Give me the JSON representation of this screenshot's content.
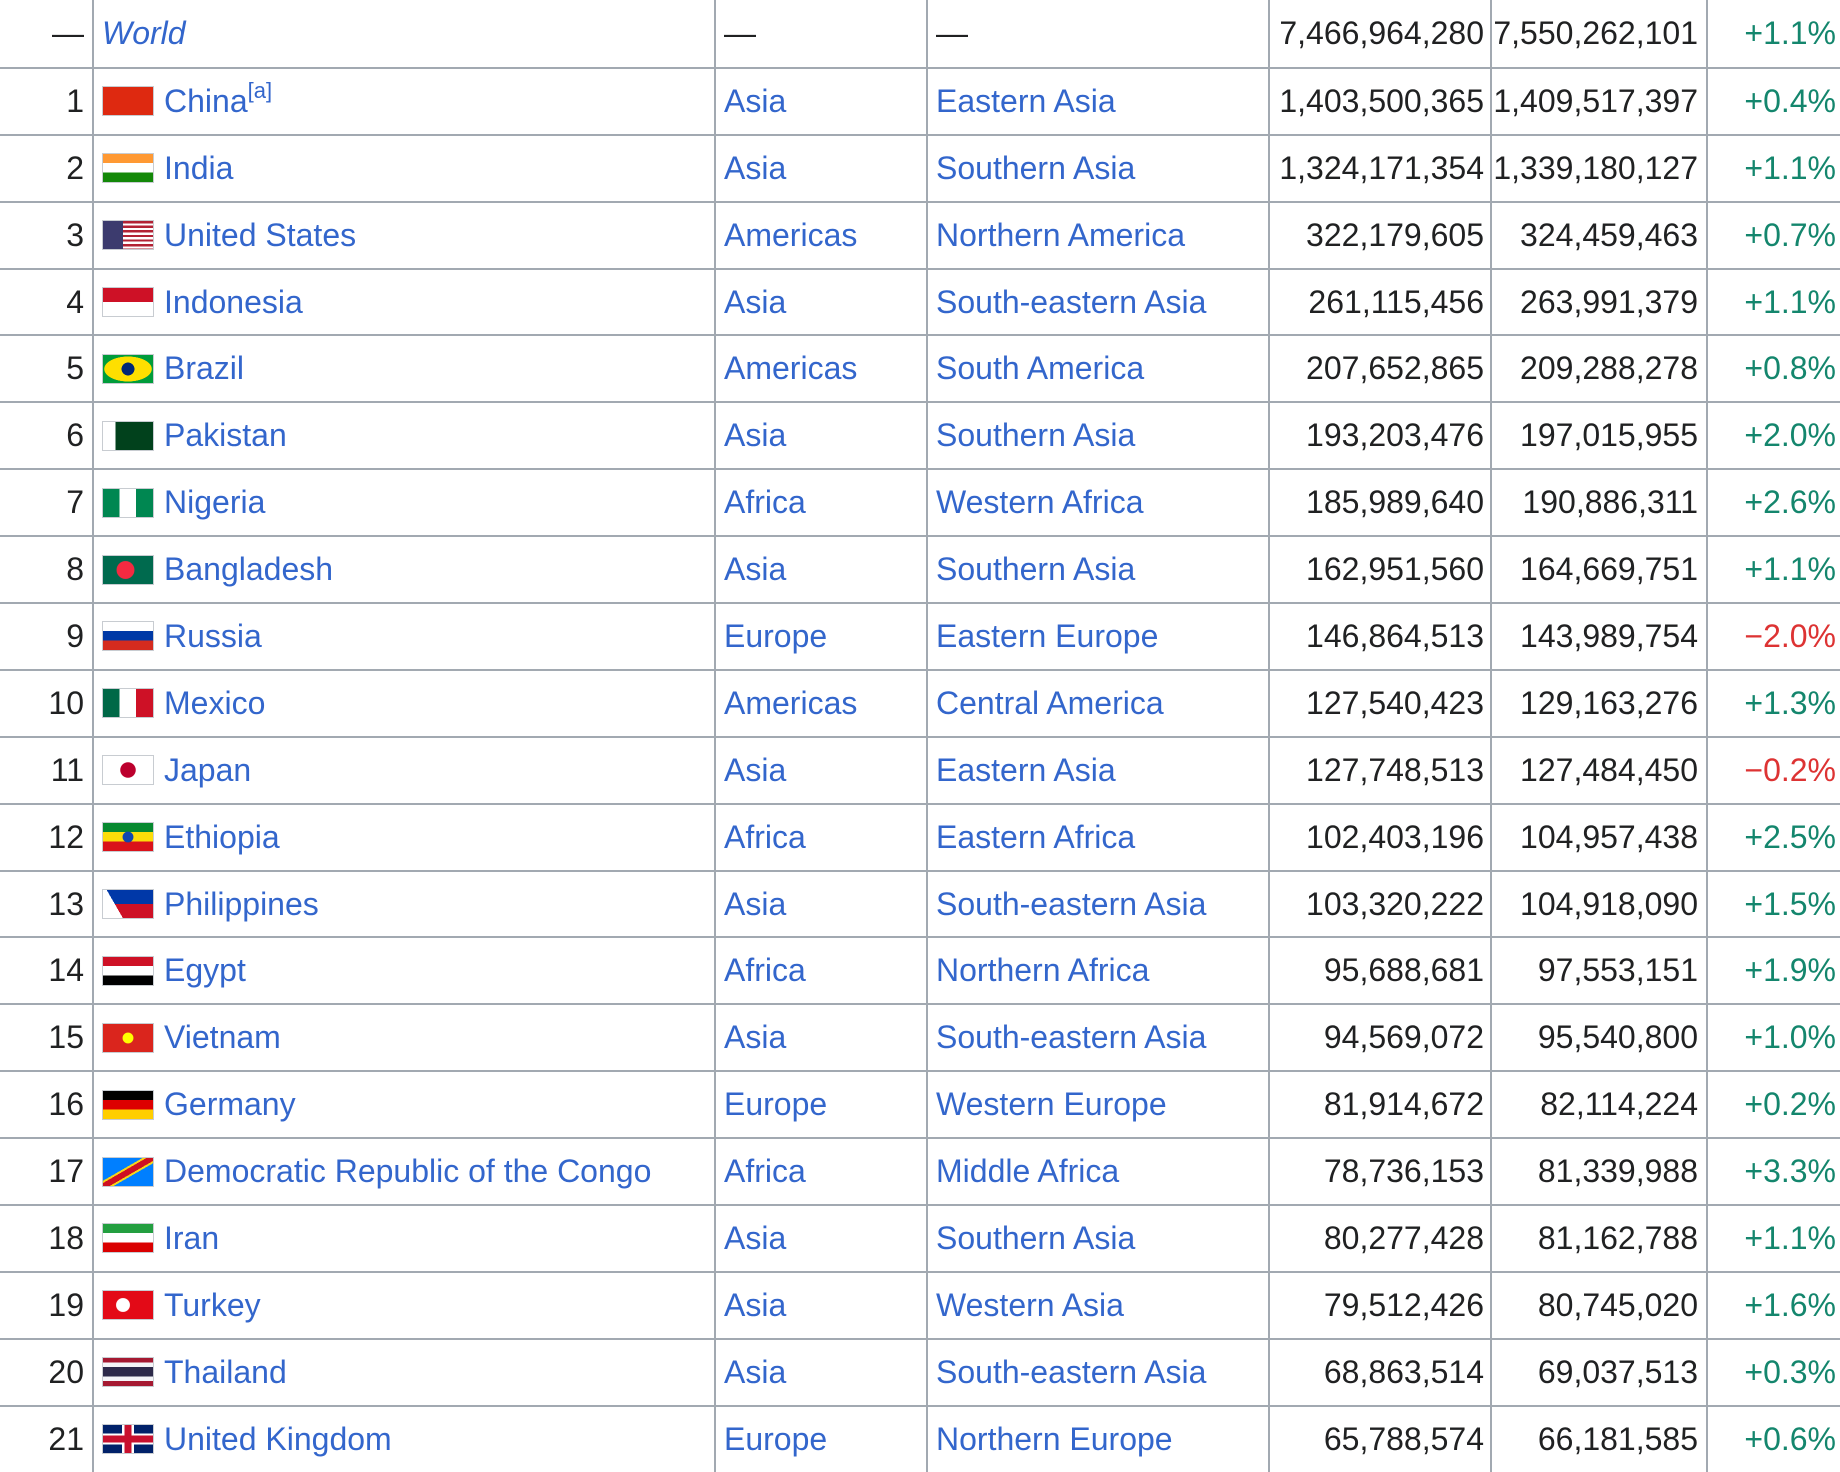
{
  "rows": [
    {
      "rank": "—",
      "country": "World",
      "note": "",
      "region": "—",
      "subregion": "—",
      "p2016": "7,466,964,280",
      "p2017": "7,550,262,101",
      "change": "+1.1%",
      "dir": "pos",
      "flag": "",
      "world": true
    },
    {
      "rank": "1",
      "country": "China",
      "note": "[a]",
      "region": "Asia",
      "subregion": "Eastern Asia",
      "p2016": "1,403,500,365",
      "p2017": "1,409,517,397",
      "change": "+0.4%",
      "dir": "pos",
      "flag": "linear-gradient(#de2910,#de2910)"
    },
    {
      "rank": "2",
      "country": "India",
      "note": "",
      "region": "Asia",
      "subregion": "Southern Asia",
      "p2016": "1,324,171,354",
      "p2017": "1,339,180,127",
      "change": "+1.1%",
      "dir": "pos",
      "flag": "linear-gradient(#ff9933 0 33%,#ffffff 33% 66%,#138808 66%)"
    },
    {
      "rank": "3",
      "country": "United States",
      "note": "",
      "region": "Americas",
      "subregion": "Northern America",
      "p2016": "322,179,605",
      "p2017": "324,459,463",
      "change": "+0.7%",
      "dir": "pos",
      "flag": "linear-gradient(90deg,#3c3b6e 0 40%,transparent 40%),repeating-linear-gradient(#b22234 0 2.3px,#ffffff 2.3px 4.6px)"
    },
    {
      "rank": "4",
      "country": "Indonesia",
      "note": "",
      "region": "Asia",
      "subregion": "South-eastern Asia",
      "p2016": "261,115,456",
      "p2017": "263,991,379",
      "change": "+1.1%",
      "dir": "pos",
      "flag": "linear-gradient(#ce1126 0 50%,#ffffff 50%)"
    },
    {
      "rank": "5",
      "country": "Brazil",
      "note": "",
      "region": "Americas",
      "subregion": "South America",
      "p2016": "207,652,865",
      "p2017": "209,288,278",
      "change": "+0.8%",
      "dir": "pos",
      "flag": "radial-gradient(circle,#002776 0 22%,transparent 23%),radial-gradient(ellipse 48% 45%,#fedf00 0 98%,transparent 100%),linear-gradient(#009c3b,#009c3b)"
    },
    {
      "rank": "6",
      "country": "Pakistan",
      "note": "",
      "region": "Asia",
      "subregion": "Southern Asia",
      "p2016": "193,203,476",
      "p2017": "197,015,955",
      "change": "+2.0%",
      "dir": "pos",
      "flag": "linear-gradient(90deg,#ffffff 0 25%,#01411c 25%)"
    },
    {
      "rank": "7",
      "country": "Nigeria",
      "note": "",
      "region": "Africa",
      "subregion": "Western Africa",
      "p2016": "185,989,640",
      "p2017": "190,886,311",
      "change": "+2.6%",
      "dir": "pos",
      "flag": "linear-gradient(90deg,#008751 0 33%,#ffffff 33% 66%,#008751 66%)"
    },
    {
      "rank": "8",
      "country": "Bangladesh",
      "note": "",
      "region": "Asia",
      "subregion": "Southern Asia",
      "p2016": "162,951,560",
      "p2017": "164,669,751",
      "change": "+1.1%",
      "dir": "pos",
      "flag": "radial-gradient(circle at 45% 50%,#f42a41 0 28%,transparent 30%),linear-gradient(#006a4e,#006a4e)"
    },
    {
      "rank": "9",
      "country": "Russia",
      "note": "",
      "region": "Europe",
      "subregion": "Eastern Europe",
      "p2016": "146,864,513",
      "p2017": "143,989,754",
      "change": "−2.0%",
      "dir": "neg",
      "flag": "linear-gradient(#ffffff 0 33%,#0039a6 33% 66%,#d52b1e 66%)"
    },
    {
      "rank": "10",
      "country": "Mexico",
      "note": "",
      "region": "Americas",
      "subregion": "Central America",
      "p2016": "127,540,423",
      "p2017": "129,163,276",
      "change": "+1.3%",
      "dir": "pos",
      "flag": "linear-gradient(90deg,#006847 0 33%,#ffffff 33% 66%,#ce1126 66%)"
    },
    {
      "rank": "11",
      "country": "Japan",
      "note": "",
      "region": "Asia",
      "subregion": "Eastern Asia",
      "p2016": "127,748,513",
      "p2017": "127,484,450",
      "change": "−0.2%",
      "dir": "neg",
      "flag": "radial-gradient(circle,#bc002d 0 26%,transparent 28%),linear-gradient(#ffffff,#ffffff)"
    },
    {
      "rank": "12",
      "country": "Ethiopia",
      "note": "",
      "region": "Africa",
      "subregion": "Eastern Africa",
      "p2016": "102,403,196",
      "p2017": "104,957,438",
      "change": "+2.5%",
      "dir": "pos",
      "flag": "radial-gradient(circle,#0f47af 0 18%,transparent 20%),linear-gradient(#078930 0 33%,#fcdd09 33% 66%,#da121a 66%)"
    },
    {
      "rank": "13",
      "country": "Philippines",
      "note": "",
      "region": "Asia",
      "subregion": "South-eastern Asia",
      "p2016": "103,320,222",
      "p2017": "104,918,090",
      "change": "+1.5%",
      "dir": "pos",
      "flag": "linear-gradient(60deg,#ffffff 0 30%,transparent 30%),linear-gradient(120deg,transparent 0 70%,transparent 70%),linear-gradient(#0038a8 0 50%,#ce1126 50%)"
    },
    {
      "rank": "14",
      "country": "Egypt",
      "note": "",
      "region": "Africa",
      "subregion": "Northern Africa",
      "p2016": "95,688,681",
      "p2017": "97,553,151",
      "change": "+1.9%",
      "dir": "pos",
      "flag": "linear-gradient(#ce1126 0 33%,#ffffff 33% 66%,#000000 66%)"
    },
    {
      "rank": "15",
      "country": "Vietnam",
      "note": "",
      "region": "Asia",
      "subregion": "South-eastern Asia",
      "p2016": "94,569,072",
      "p2017": "95,540,800",
      "change": "+1.0%",
      "dir": "pos",
      "flag": "radial-gradient(circle,#ffff00 0 18%,transparent 20%),linear-gradient(#da251d,#da251d)"
    },
    {
      "rank": "16",
      "country": "Germany",
      "note": "",
      "region": "Europe",
      "subregion": "Western Europe",
      "p2016": "81,914,672",
      "p2017": "82,114,224",
      "change": "+0.2%",
      "dir": "pos",
      "flag": "linear-gradient(#000000 0 33%,#dd0000 33% 66%,#ffce00 66%)"
    },
    {
      "rank": "17",
      "country": "Democratic Republic of the Congo",
      "note": "",
      "region": "Africa",
      "subregion": "Middle Africa",
      "p2016": "78,736,153",
      "p2017": "81,339,988",
      "change": "+3.3%",
      "dir": "pos",
      "flag": "linear-gradient(150deg,transparent 0 40%,#f7d618 40% 44%,#ce1021 44% 56%,#f7d618 56% 60%,transparent 60%),linear-gradient(#007fff,#007fff)"
    },
    {
      "rank": "18",
      "country": "Iran",
      "note": "",
      "region": "Asia",
      "subregion": "Southern Asia",
      "p2016": "80,277,428",
      "p2017": "81,162,788",
      "change": "+1.1%",
      "dir": "pos",
      "flag": "linear-gradient(#239f40 0 33%,#ffffff 33% 66%,#da0000 66%)"
    },
    {
      "rank": "19",
      "country": "Turkey",
      "note": "",
      "region": "Asia",
      "subregion": "Western Asia",
      "p2016": "79,512,426",
      "p2017": "80,745,020",
      "change": "+1.6%",
      "dir": "pos",
      "flag": "radial-gradient(circle at 40% 50%,#ffffff 0 20%,transparent 22%),linear-gradient(#e30a17,#e30a17)"
    },
    {
      "rank": "20",
      "country": "Thailand",
      "note": "",
      "region": "Asia",
      "subregion": "South-eastern Asia",
      "p2016": "68,863,514",
      "p2017": "69,037,513",
      "change": "+0.3%",
      "dir": "pos",
      "flag": "linear-gradient(#a51931 0 16%,#f4f5f8 16% 33%,#2d2a4a 33% 66%,#f4f5f8 66% 83%,#a51931 83%)"
    },
    {
      "rank": "21",
      "country": "United Kingdom",
      "note": "",
      "region": "Europe",
      "subregion": "Northern Europe",
      "p2016": "65,788,574",
      "p2017": "66,181,585",
      "change": "+0.6%",
      "dir": "pos",
      "flag": "linear-gradient(90deg,transparent 0 43%,#c8102e 43% 57%,transparent 57%),linear-gradient(transparent 0 38%,#c8102e 38% 62%,transparent 62%),linear-gradient(90deg,transparent 0 38%,#ffffff 38% 62%,transparent 62%),linear-gradient(transparent 0 30%,#ffffff 30% 70%,transparent 70%),linear-gradient(#012169,#012169)"
    }
  ]
}
